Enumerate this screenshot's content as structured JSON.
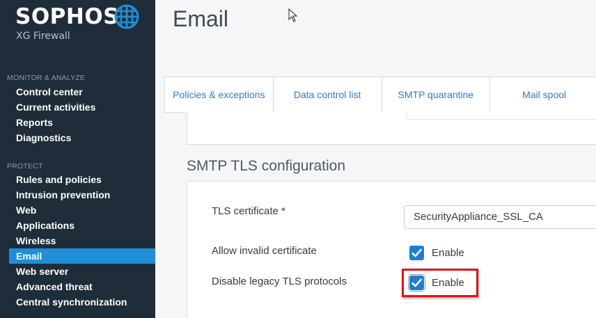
{
  "brand": {
    "name": "SOPHOS",
    "product": "XG Firewall"
  },
  "sidebar": {
    "sections": [
      {
        "title": "MONITOR & ANALYZE",
        "items": [
          "Control center",
          "Current activities",
          "Reports",
          "Diagnostics"
        ]
      },
      {
        "title": "PROTECT",
        "items": [
          "Rules and policies",
          "Intrusion prevention",
          "Web",
          "Applications",
          "Wireless",
          "Email",
          "Web server",
          "Advanced threat",
          "Central synchronization"
        ]
      }
    ],
    "active_item": "Email"
  },
  "page": {
    "title": "Email"
  },
  "tabs": [
    "Policies & exceptions",
    "Data control list",
    "SMTP quarantine",
    "Mail spool"
  ],
  "smtp_tls": {
    "section_title": "SMTP TLS configuration",
    "tls_certificate_label": "TLS certificate *",
    "tls_certificate_value": "SecurityAppliance_SSL_CA",
    "allow_invalid_label": "Allow invalid certificate",
    "allow_invalid_checked": true,
    "allow_invalid_option": "Enable",
    "disable_legacy_label": "Disable legacy TLS protocols",
    "disable_legacy_checked": true,
    "disable_legacy_option": "Enable"
  },
  "colors": {
    "sidebar_bg": "#1f2d3a",
    "active_item": "#1e8fd6",
    "checkbox": "#1e7fd1",
    "highlight": "#e0141b",
    "tab_text": "#2a7cc7"
  }
}
